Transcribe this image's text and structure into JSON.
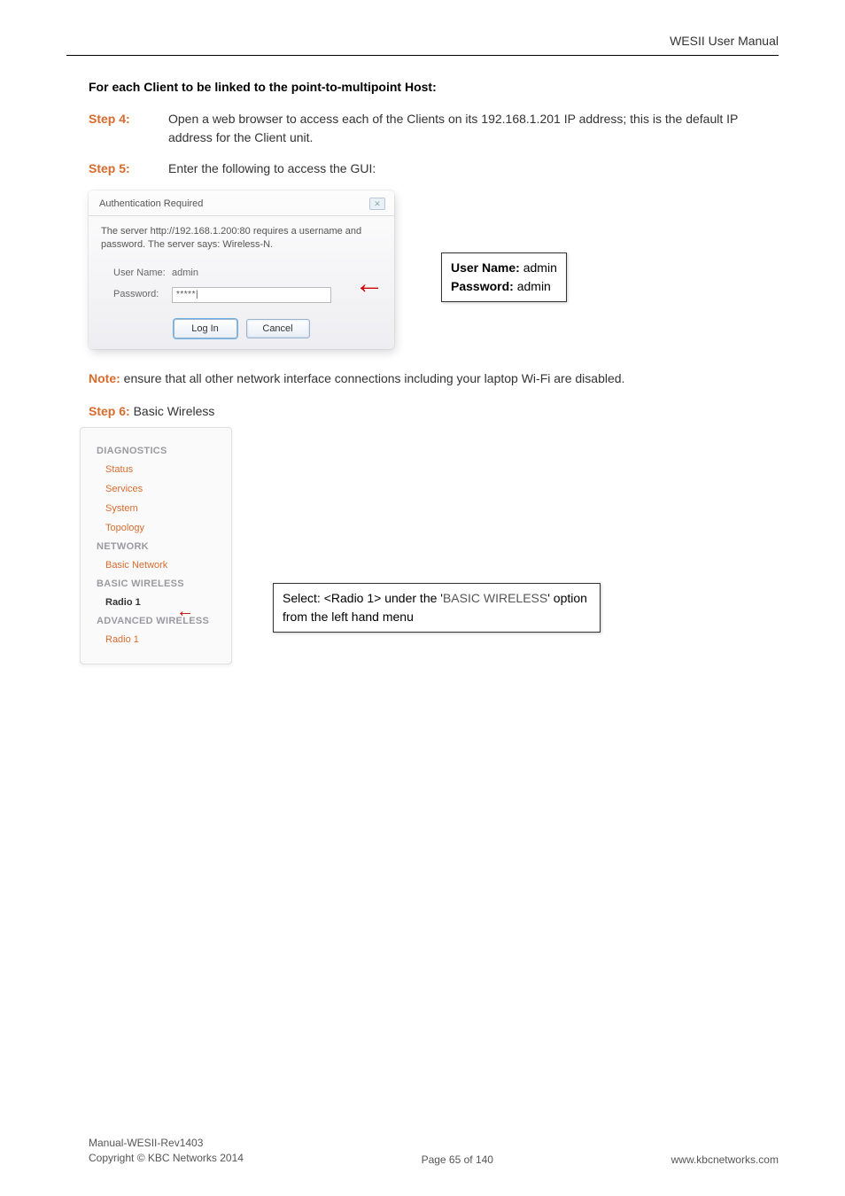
{
  "header": {
    "title": "WESII User Manual"
  },
  "body": {
    "heading": "For each Client to be linked to the point-to-multipoint Host:",
    "step4": {
      "label": "Step 4:",
      "text": "Open a web browser to access each of the Clients on its 192.168.1.201 IP address; this is the default IP address for the Client unit."
    },
    "step5": {
      "label": "Step 5:",
      "text": "Enter the following to access the GUI:"
    },
    "note": {
      "label": "Note:",
      "text": " ensure that all other network interface connections including your laptop Wi-Fi are disabled."
    },
    "step6": {
      "label": "Step 6:",
      "text": " Basic Wireless"
    }
  },
  "dialog": {
    "title": "Authentication Required",
    "close_glyph": "✕",
    "message": "The server http://192.168.1.200:80 requires a username and password. The server says: Wireless-N.",
    "username_label": "User Name:",
    "username_value": "admin",
    "password_label": "Password:",
    "password_mask": "*****",
    "login_btn": "Log In",
    "cancel_btn": "Cancel"
  },
  "callout1": {
    "l1a": "User Name:",
    "l1b": "admin",
    "l2a": "Password:",
    "l2b": "admin"
  },
  "sidebar": {
    "g1": "DIAGNOSTICS",
    "i1": "Status",
    "i2": "Services",
    "i3": "System",
    "i4": "Topology",
    "g2": "NETWORK",
    "i5": "Basic Network",
    "g3": "BASIC WIRELESS",
    "i6": "Radio 1",
    "g4": "ADVANCED WIRELESS",
    "i7": "Radio 1"
  },
  "callout2": {
    "p1": "Select:",
    "p2": "  <",
    "p3": "Radio 1",
    "p4": ">",
    "p5": " under the '",
    "p6": "BASIC WIRELESS",
    "p7": "' option from the left hand menu"
  },
  "footer": {
    "line1": "Manual-WESII-Rev1403",
    "line2": "Copyright © KBC Networks 2014",
    "page": "Page 65 of 140",
    "url": "www.kbcnetworks.com"
  }
}
